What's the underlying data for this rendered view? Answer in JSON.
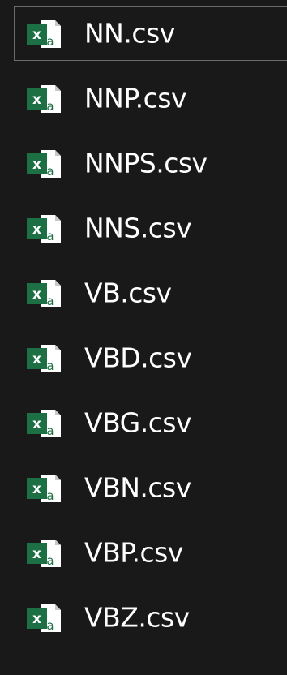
{
  "files": [
    {
      "name": "NN.csv",
      "icon": "excel-csv-icon",
      "selected": true
    },
    {
      "name": "NNP.csv",
      "icon": "excel-csv-icon",
      "selected": false
    },
    {
      "name": "NNPS.csv",
      "icon": "excel-csv-icon",
      "selected": false
    },
    {
      "name": "NNS.csv",
      "icon": "excel-csv-icon",
      "selected": false
    },
    {
      "name": "VB.csv",
      "icon": "excel-csv-icon",
      "selected": false
    },
    {
      "name": "VBD.csv",
      "icon": "excel-csv-icon",
      "selected": false
    },
    {
      "name": "VBG.csv",
      "icon": "excel-csv-icon",
      "selected": false
    },
    {
      "name": "VBN.csv",
      "icon": "excel-csv-icon",
      "selected": false
    },
    {
      "name": "VBP.csv",
      "icon": "excel-csv-icon",
      "selected": false
    },
    {
      "name": "VBZ.csv",
      "icon": "excel-csv-icon",
      "selected": false
    }
  ],
  "colors": {
    "background": "#191919",
    "excel_green": "#1d7044",
    "text": "#ffffff",
    "selection_border": "#6b6b6b"
  }
}
